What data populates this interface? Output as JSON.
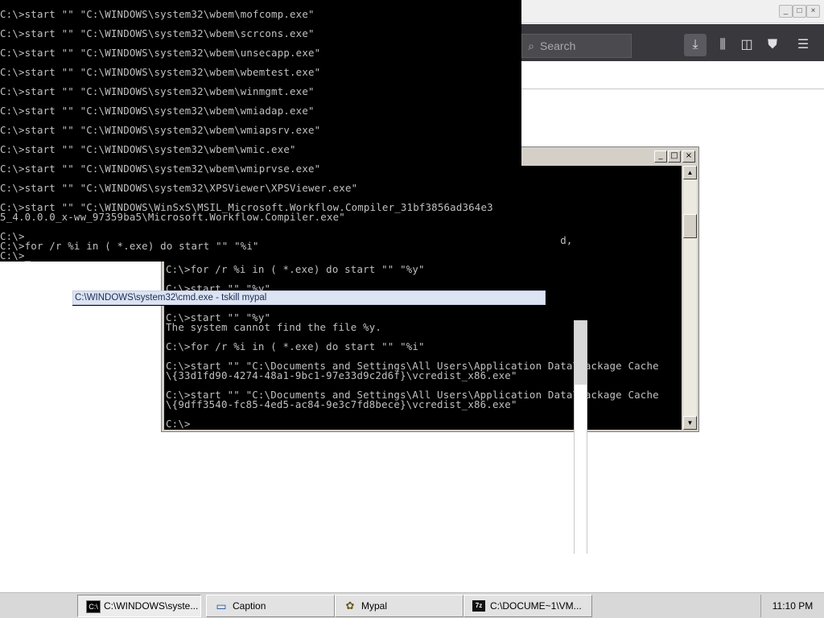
{
  "firefox": {
    "search_placeholder": "Search",
    "icons": [
      "search-icon",
      "download-icon",
      "library-icon",
      "sidebar-icon",
      "extension-icon",
      "menu-icon"
    ],
    "caption_buttons": [
      "_",
      "□",
      "×"
    ]
  },
  "cmd_main": {
    "lines": [
      "C:\\>start \"\" \"C:\\WINDOWS\\system32\\wbem\\mofcomp.exe\"",
      "",
      "C:\\>start \"\" \"C:\\WINDOWS\\system32\\wbem\\scrcons.exe\"",
      "",
      "C:\\>start \"\" \"C:\\WINDOWS\\system32\\wbem\\unsecapp.exe\"",
      "",
      "C:\\>start \"\" \"C:\\WINDOWS\\system32\\wbem\\wbemtest.exe\"",
      "",
      "C:\\>start \"\" \"C:\\WINDOWS\\system32\\wbem\\winmgmt.exe\"",
      "",
      "C:\\>start \"\" \"C:\\WINDOWS\\system32\\wbem\\wmiadap.exe\"",
      "",
      "C:\\>start \"\" \"C:\\WINDOWS\\system32\\wbem\\wmiapsrv.exe\"",
      "",
      "C:\\>start \"\" \"C:\\WINDOWS\\system32\\wbem\\wmic.exe\"",
      "",
      "C:\\>start \"\" \"C:\\WINDOWS\\system32\\wbem\\wmiprvse.exe\"",
      "",
      "C:\\>start \"\" \"C:\\WINDOWS\\system32\\XPSViewer\\XPSViewer.exe\"",
      "",
      "C:\\>start \"\" \"C:\\WINDOWS\\WinSxS\\MSIL_Microsoft.Workflow.Compiler_31bf3856ad364e3",
      "5_4.0.0.0_x-ww_97359ba5\\Microsoft.Workflow.Compiler.exe\"",
      "",
      "C:\\>",
      "C:\\>for /r %i in ( *.exe) do start \"\" \"%i\"",
      "C:\\>_"
    ]
  },
  "cmd_second": {
    "caption_buttons": [
      "_",
      "□",
      "×"
    ],
    "lines": [
      "",
      "",
      "",
      "",
      "",
      "",
      "",
      "                                                                d,",
      "",
      "",
      "C:\\>for /r %i in ( *.exe) do start \"\" \"%y\"",
      "",
      "C:\\>start \"\" \"%y\"",
      "",
      "",
      "C:\\>start \"\" \"%y\"",
      "The system cannot find the file %y.",
      "",
      "C:\\>for /r %i in ( *.exe) do start \"\" \"%i\"",
      "",
      "C:\\>start \"\" \"C:\\Documents and Settings\\All Users\\Application Data\\Package Cache",
      "\\{33d1fd90-4274-48a1-9bc1-97e33d9c2d6f}\\vcredist_x86.exe\"",
      "",
      "C:\\>start \"\" \"C:\\Documents and Settings\\All Users\\Application Data\\Package Cache",
      "\\{9dff3540-fc85-4ed5-ac84-9e3c7fd8bece}\\vcredist_x86.exe\"",
      "",
      "C:\\>"
    ],
    "scroll_up": "▲",
    "scroll_down": "▼"
  },
  "tooltip": {
    "text": "C:\\WINDOWS\\system32\\cmd.exe - tskill mypal"
  },
  "taskbar": {
    "buttons": [
      {
        "label": "C:\\WINDOWS\\syste...",
        "icon": "cmd-icon",
        "glyph": "C:\\"
      },
      {
        "label": "Caption",
        "icon": "caption-window-icon",
        "glyph": "▭"
      },
      {
        "label": "Mypal",
        "icon": "mypal-icon",
        "glyph": "✿"
      },
      {
        "label": "C:\\DOCUME~1\\VM...",
        "icon": "7zip-icon",
        "glyph": "7z"
      }
    ],
    "clock": "11:10 PM"
  }
}
